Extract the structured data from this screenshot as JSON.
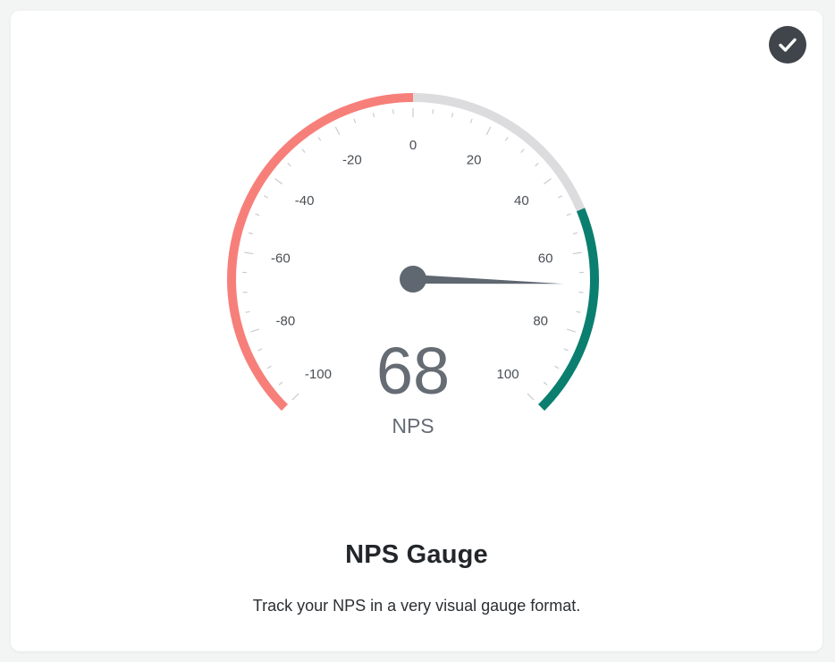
{
  "card": {
    "title": "NPS Gauge",
    "description": "Track your NPS in a very visual gauge format."
  },
  "badge": {
    "icon": "checkmark-icon",
    "color": "#3f454b"
  },
  "gauge": {
    "value": 68,
    "value_text": "68",
    "unit_label": "NPS",
    "min": -100,
    "max": 100,
    "tick_labels": [
      "-100",
      "-80",
      "-60",
      "-40",
      "-20",
      "0",
      "20",
      "40",
      "60",
      "80",
      "100"
    ],
    "bands": [
      {
        "from": -100,
        "to": 0,
        "color": "#f77f7a"
      },
      {
        "from": 0,
        "to": 50,
        "color": "#dcdcdf"
      },
      {
        "from": 50,
        "to": 100,
        "color": "#0b7f6f"
      }
    ],
    "needle_color": "#5f6770",
    "text_color": "#666c74"
  }
}
